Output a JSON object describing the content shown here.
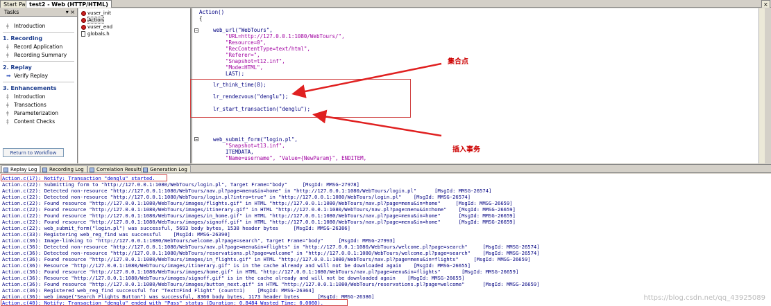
{
  "doc_tabs": [
    "Start Page",
    "test2 - Web (HTTP/HTML)"
  ],
  "tasks": {
    "header": "Tasks",
    "intro": "Introduction",
    "sections": [
      {
        "title": "1. Recording",
        "items": [
          "Record Application",
          "Recording Summary"
        ]
      },
      {
        "title": "2. Replay",
        "items": [
          "Verify Replay"
        ]
      },
      {
        "title": "3. Enhancements",
        "items": [
          "Introduction",
          "Transactions",
          "Parameterization",
          "Content Checks"
        ]
      }
    ],
    "return_button": "Return to Workflow"
  },
  "tree": [
    "vuser_init",
    "Action",
    "vuser_end",
    "globals.h"
  ],
  "code": [
    "Action()",
    "{",
    "web_url(\"WebTours\",",
    "\"URL=http://127.0.0.1:1080/WebTours/\",",
    "\"Resource=0\",",
    "\"RecContentType=text/html\",",
    "\"Referer=\",",
    "\"Snapshot=t12.inf\",",
    "\"Mode=HTML\",",
    "LAST);",
    "lr_think_time(8);",
    "lr_rendezvous(\"denglu\");",
    "lr_start_transaction(\"denglu\");",
    "web_submit_form(\"login.pl\",",
    "\"Snapshot=t13.inf\",",
    "ITEMDATA,",
    "\"Name=username\", \"Value={NewParam}\", ENDITEM,"
  ],
  "annotations": {
    "rendezvous": "集合点",
    "transaction": "插入事务"
  },
  "log_tabs": [
    "Replay Log",
    "Recording Log",
    "Correlation Results",
    "Generation Log"
  ],
  "log": [
    "Action.c(17): Notify: Transaction \"denglu\" started.",
    "Action.c(22): Submitting form to \"http://127.0.0.1:1080/WebTours/login.pl\", Target Frame=\"body\"     [MsgId: MMSG-27978]",
    "Action.c(22): Detected non-resource \"http://127.0.0.1:1080/WebTours/nav.pl?page=menu&in=home\" in \"http://127.0.0.1:1080/WebTours/login.pl\"      [MsgId: MMSG-26574]",
    "Action.c(22): Detected non-resource \"http://127.0.0.1:1080/WebTours/login.pl?intro=true\" in \"http://127.0.0.1:1080/WebTours/login.pl\"    [MsgId: MMSG-26574]",
    "Action.c(22): Found resource \"http://127.0.0.1:1080/WebTours/images/flights.gif\" in HTML \"http://127.0.0.1:1080/WebTours/nav.pl?page=menu&in=home\"     [MsgId: MMSG-26659]",
    "Action.c(22): Found resource \"http://127.0.0.1:1080/WebTours/images/itinerary.gif\" in HTML \"http://127.0.0.1:1080/WebTours/nav.pl?page=menu&in=home\"    [MsgId: MMSG-26659]",
    "Action.c(22): Found resource \"http://127.0.0.1:1080/WebTours/images/in_home.gif\" in HTML \"http://127.0.0.1:1080/WebTours/nav.pl?page=menu&in=home\"      [MsgId: MMSG-26659]",
    "Action.c(22): Found resource \"http://127.0.0.1:1080/WebTours/images/signoff.gif\" in HTML \"http://127.0.0.1:1080/WebTours/nav.pl?page=menu&in=home\"      [MsgId: MMSG-26659]",
    "Action.c(22): web_submit_form(\"login.pl\") was successful, 5693 body bytes, 1538 header bytes     [MsgId: MMSG-26386]",
    "Action.c(33): Registering web_reg_find was successful    [MsgId: MMSG-26390]",
    "Action.c(36): Image-linking to \"http://127.0.0.1:1080/WebTours/welcome.pl?page=search\", Target Frame=\"body\"     [MsgId: MMSG-27993]",
    "Action.c(36): Detected non-resource \"http://127.0.0.1:1080/WebTours/nav.pl?page=menu&in=flights\" in \"http://127.0.0.1:1080/WebTours/welcome.pl?page=search\"     [MsgId: MMSG-26574]",
    "Action.c(36): Detected non-resource \"http://127.0.0.1:1080/WebTours/reservations.pl?page=welcome\" in \"http://127.0.0.1:1080/WebTours/welcome.pl?page=search\"    [MsgId: MMSG-26574]",
    "Action.c(36): Found resource \"http://127.0.0.1:1080/WebTours/images/in_flights.gif\" in HTML \"http://127.0.0.1:1080/WebTours/nav.pl?page=menu&in=flights\"     [MsgId: MMSG-26659]",
    "Action.c(36): Resource \"http://127.0.0.1:1080/WebTours/images/itinerary.gif\" is in the cache already and will not be downloaded again    [MsgId: MMSG-26655]",
    "Action.c(36): Found resource \"http://127.0.0.1:1080/WebTours/images/home.gif\" in HTML \"http://127.0.0.1:1080/WebTours/nav.pl?page=menu&in=flights\"       [MsgId: MMSG-26659]",
    "Action.c(36): Resource \"http://127.0.0.1:1080/WebTours/images/signoff.gif\" is in the cache already and will not be downloaded again    [MsgId: MMSG-26655]",
    "Action.c(36): Found resource \"http://127.0.0.1:1080/WebTours/images/button_next.gif\" in HTML \"http://127.0.0.1:1080/WebTours/reservations.pl?page=welcome\"      [MsgId: MMSG-26659]",
    "Action.c(36): Registered web_reg_find successful for \"Text=Find Flight\" (count=1)    [MsgId: MMSG-26364]",
    "Action.c(36): web_image(\"Search Flights Button\") was successful, 8360 body bytes, 1173 header bytes      [MsgId: MMSG-26386]",
    "Action.c(40): Notify: Transaction \"denglu\" ended with \"Pass\" status (Duration: 0.8484 Wasted Time: 0.0060)."
  ],
  "watermark": "https://blog.csdn.net/qq_43925089"
}
